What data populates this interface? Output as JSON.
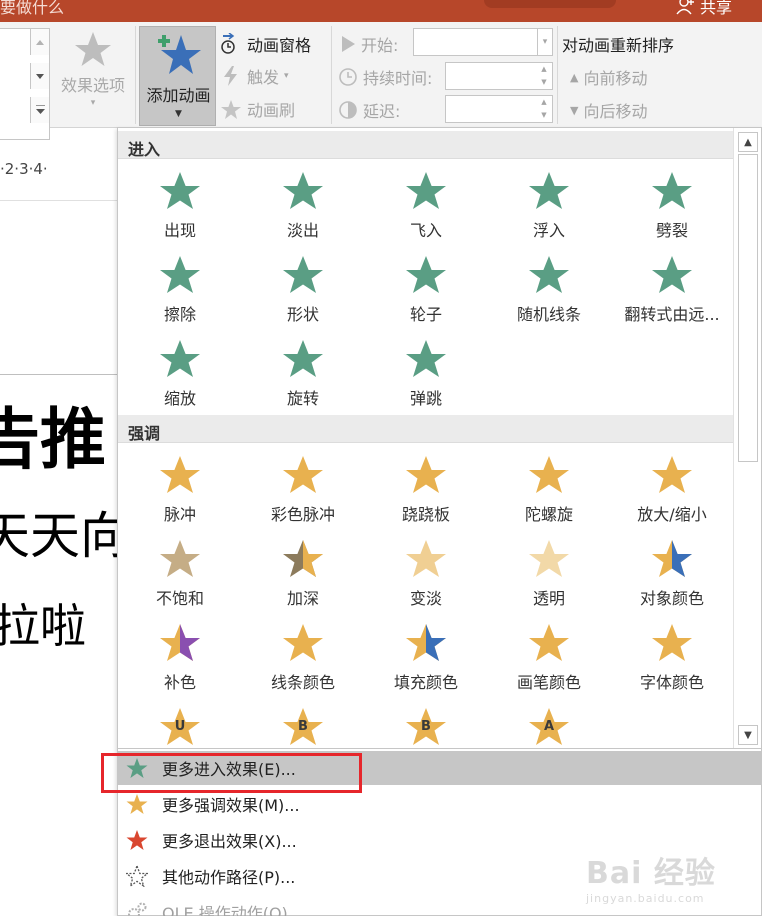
{
  "titlebar": {
    "tell_me": "要做什么",
    "share": "共享"
  },
  "ribbon": {
    "effect_options": "效果选项",
    "add_animation": "添加动画",
    "animation_pane": "动画窗格",
    "trigger": "触发",
    "animation_painter": "动画刷",
    "start_label": "开始:",
    "duration_label": "持续时间:",
    "delay_label": "延迟:",
    "reorder_title": "对动画重新排序",
    "move_earlier": "向前移动",
    "move_later": "向后移动"
  },
  "ruler": {
    "text": "·2·3·4·"
  },
  "slide": {
    "line1": "告推",
    "line2": "天天向",
    "line3": "拉啦"
  },
  "gallery": {
    "entrance_header": "进入",
    "entrance": [
      {
        "label": "出现",
        "icon": "star-appear-icon"
      },
      {
        "label": "淡出",
        "icon": "star-fade-icon"
      },
      {
        "label": "飞入",
        "icon": "star-fly-in-icon"
      },
      {
        "label": "浮入",
        "icon": "star-float-in-icon"
      },
      {
        "label": "劈裂",
        "icon": "star-split-icon"
      },
      {
        "label": "擦除",
        "icon": "star-wipe-icon"
      },
      {
        "label": "形状",
        "icon": "star-shape-icon"
      },
      {
        "label": "轮子",
        "icon": "star-wheel-icon"
      },
      {
        "label": "随机线条",
        "icon": "star-random-bars-icon"
      },
      {
        "label": "翻转式由远...",
        "icon": "star-grow-turn-icon"
      },
      {
        "label": "缩放",
        "icon": "star-zoom-icon"
      },
      {
        "label": "旋转",
        "icon": "star-swivel-icon"
      },
      {
        "label": "弹跳",
        "icon": "star-bounce-icon"
      }
    ],
    "emphasis_header": "强调",
    "emphasis": [
      {
        "label": "脉冲",
        "icon": "star-pulse-icon"
      },
      {
        "label": "彩色脉冲",
        "icon": "star-color-pulse-icon"
      },
      {
        "label": "跷跷板",
        "icon": "star-teeter-icon"
      },
      {
        "label": "陀螺旋",
        "icon": "star-spin-icon"
      },
      {
        "label": "放大/缩小",
        "icon": "star-grow-shrink-icon"
      },
      {
        "label": "不饱和",
        "icon": "star-desaturate-icon"
      },
      {
        "label": "加深",
        "icon": "star-darken-icon"
      },
      {
        "label": "变淡",
        "icon": "star-lighten-icon"
      },
      {
        "label": "透明",
        "icon": "star-transparency-icon"
      },
      {
        "label": "对象颜色",
        "icon": "star-object-color-icon"
      },
      {
        "label": "补色",
        "icon": "star-complementary-color-icon"
      },
      {
        "label": "线条颜色",
        "icon": "star-line-color-icon"
      },
      {
        "label": "填充颜色",
        "icon": "star-fill-color-icon"
      },
      {
        "label": "画笔颜色",
        "icon": "star-brush-color-icon"
      },
      {
        "label": "字体颜色",
        "icon": "star-font-color-icon"
      },
      {
        "label": "",
        "icon": "star-underline-icon",
        "glyph": "U"
      },
      {
        "label": "",
        "icon": "star-bold-flash-icon",
        "glyph": "B"
      },
      {
        "label": "",
        "icon": "star-bold-reveal-icon",
        "glyph": "B"
      },
      {
        "label": "",
        "icon": "star-wave-icon",
        "glyph": "A"
      }
    ]
  },
  "menu": [
    {
      "label": "更多进入效果(E)...",
      "icon": "green-star-icon"
    },
    {
      "label": "更多强调效果(M)...",
      "icon": "gold-star-icon"
    },
    {
      "label": "更多退出效果(X)...",
      "icon": "red-star-icon"
    },
    {
      "label": "其他动作路径(P)...",
      "icon": "outline-star-icon"
    },
    {
      "label": "OLE 操作动作(O)",
      "icon": "gears-icon"
    }
  ],
  "watermark": {
    "logo": "Bai 经验",
    "url": "jingyan.baidu.com"
  },
  "colors": {
    "accent": "#b7472a",
    "entrance_green": "#5a9e84",
    "emphasis_gold": "#e8b14f",
    "exit_red": "#d9462f",
    "highlight_box": "#e6262b"
  }
}
